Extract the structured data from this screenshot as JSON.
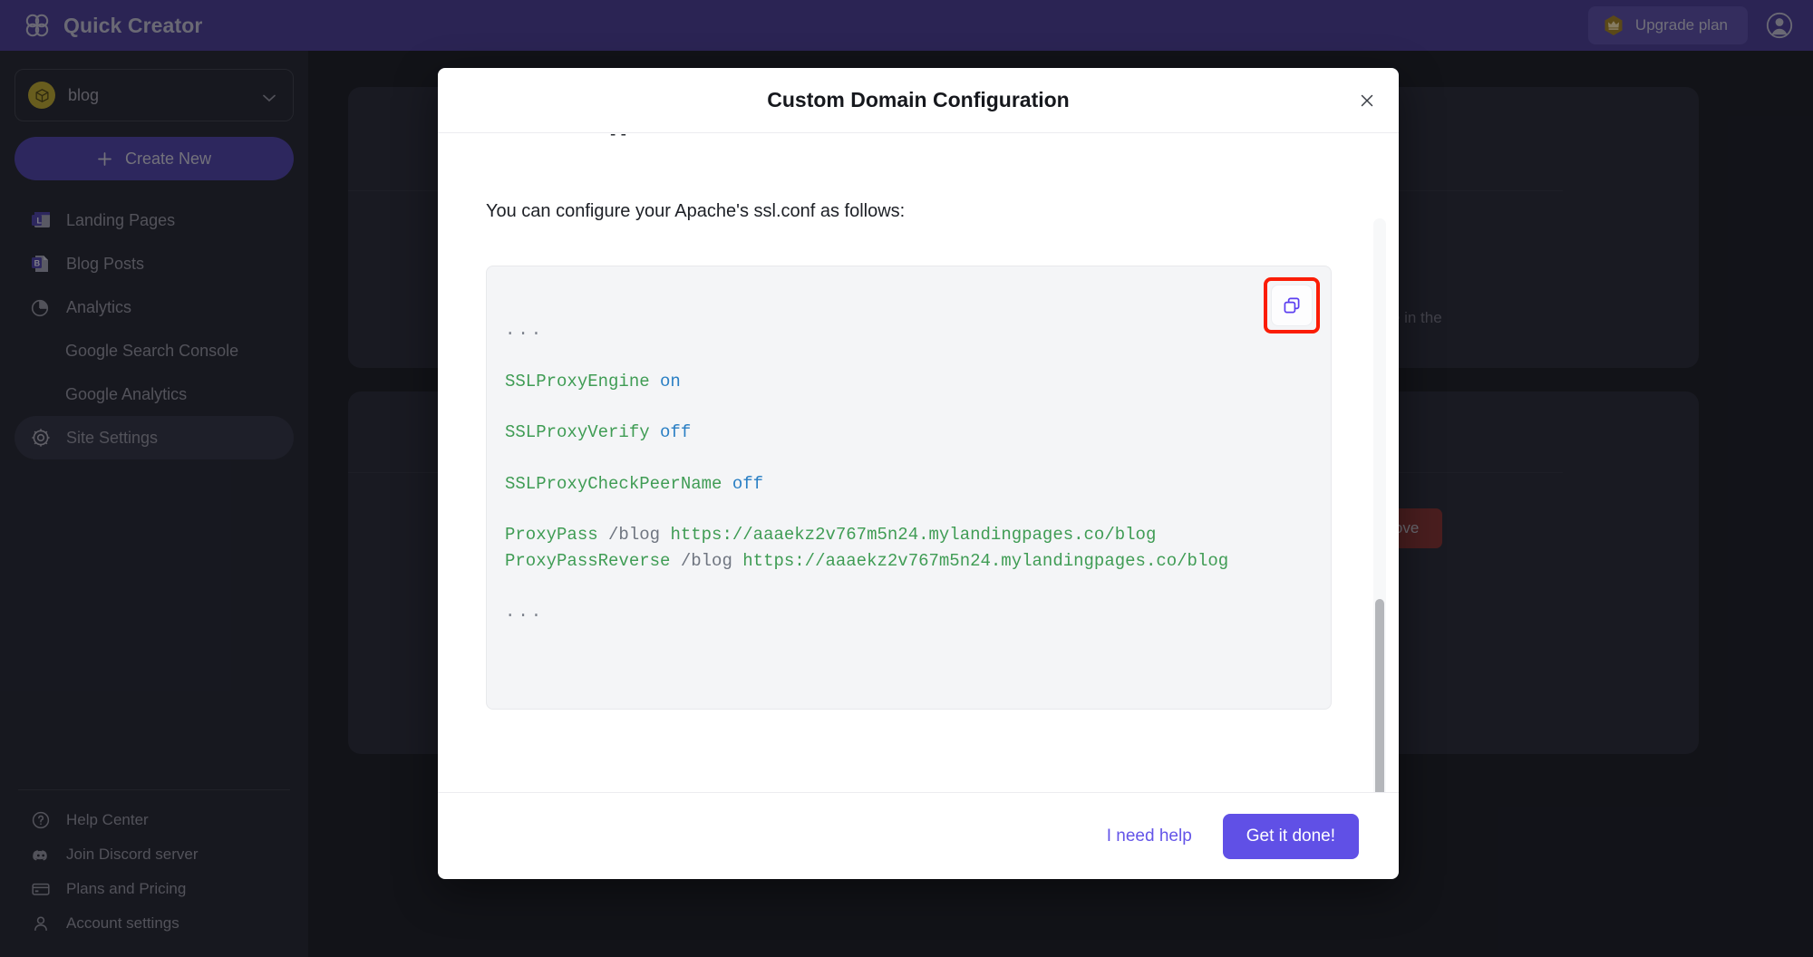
{
  "topbar": {
    "brand": "Quick Creator",
    "logo_icon": "infinity-loops-logo",
    "upgrade_label": "Upgrade plan",
    "crown_icon": "crown-badge-icon",
    "avatar_icon": "user-avatar-icon"
  },
  "sidebar": {
    "site": {
      "name": "blog",
      "avatar_icon": "cube-icon",
      "chevron_icon": "chevron-down-icon"
    },
    "create_label": "Create New",
    "plus_icon": "plus-icon",
    "items": [
      {
        "label": "Landing Pages",
        "icon": "landing-page-icon",
        "sub": false,
        "active": false
      },
      {
        "label": "Blog Posts",
        "icon": "blog-post-icon",
        "sub": false,
        "active": false
      },
      {
        "label": "Analytics",
        "icon": "pie-chart-icon",
        "sub": false,
        "active": false
      },
      {
        "label": "Google Search Console",
        "icon": "",
        "sub": true,
        "active": false
      },
      {
        "label": "Google Analytics",
        "icon": "",
        "sub": true,
        "active": false
      },
      {
        "label": "Site Settings",
        "icon": "gear-icon",
        "sub": false,
        "active": true
      }
    ],
    "bottom_items": [
      {
        "label": "Help Center",
        "icon": "question-circle-icon"
      },
      {
        "label": "Join Discord server",
        "icon": "discord-icon"
      },
      {
        "label": "Plans and Pricing",
        "icon": "credit-card-icon"
      },
      {
        "label": "Account settings",
        "icon": "person-icon"
      }
    ]
  },
  "background": {
    "card_text": "homepage in the",
    "remove_label": "Remove"
  },
  "modal": {
    "title": "Custom Domain Configuration",
    "close_icon": "close-icon",
    "clipped_text": "- -",
    "intro": "You can configure your Apache's ssl.conf as follows:",
    "copy_icon": "copy-icon",
    "code_lines": [
      {
        "parts": [
          {
            "t": "...",
            "c": "dots"
          }
        ]
      },
      {
        "parts": [
          {
            "t": "SSLProxyEngine ",
            "c": "dir"
          },
          {
            "t": "on",
            "c": "val"
          }
        ]
      },
      {
        "parts": [
          {
            "t": "SSLProxyVerify ",
            "c": "dir"
          },
          {
            "t": "off",
            "c": "val"
          }
        ]
      },
      {
        "parts": [
          {
            "t": "SSLProxyCheckPeerName ",
            "c": "dir"
          },
          {
            "t": "off",
            "c": "val"
          }
        ]
      },
      {
        "parts": [
          {
            "t": "ProxyPass ",
            "c": "dir"
          },
          {
            "t": "/blog ",
            "c": "path"
          },
          {
            "t": "https://aaaekz2v767m5n24.mylandingpages.co/blog",
            "c": "url"
          }
        ],
        "tight": true
      },
      {
        "parts": [
          {
            "t": "ProxyPassReverse ",
            "c": "dir"
          },
          {
            "t": "/blog ",
            "c": "path"
          },
          {
            "t": "https://aaaekz2v767m5n24.mylandingpages.co/blog",
            "c": "url"
          }
        ]
      },
      {
        "parts": [
          {
            "t": "...",
            "c": "dots"
          }
        ]
      }
    ],
    "help_label": "I need help",
    "done_label": "Get it done!"
  },
  "colors": {
    "topbar": "#453a8f",
    "sidebar": "#22242e",
    "accent": "#6050e6",
    "code_directive": "#3f9c54",
    "code_value": "#2a7fc4",
    "highlight": "#fb1d06",
    "danger": "#7e2f2f"
  }
}
